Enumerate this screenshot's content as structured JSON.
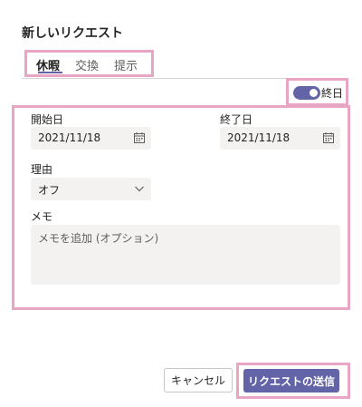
{
  "dialog": {
    "title": "新しいリクエスト"
  },
  "tabs": [
    {
      "label": "休暇",
      "active": true
    },
    {
      "label": "交換",
      "active": false
    },
    {
      "label": "提示",
      "active": false
    }
  ],
  "all_day": {
    "label": "終日",
    "on": true
  },
  "form": {
    "start_label": "開始日",
    "start_value": "2021/11/18",
    "end_label": "終了日",
    "end_value": "2021/11/18",
    "reason_label": "理由",
    "reason_value": "オフ",
    "memo_label": "メモ",
    "memo_placeholder": "メモを追加 (オプション)"
  },
  "buttons": {
    "cancel": "キャンセル",
    "submit": "リクエストの送信"
  },
  "colors": {
    "accent": "#6264a7",
    "highlight": "#e8a6c4",
    "field_bg": "#f3f2f1"
  }
}
